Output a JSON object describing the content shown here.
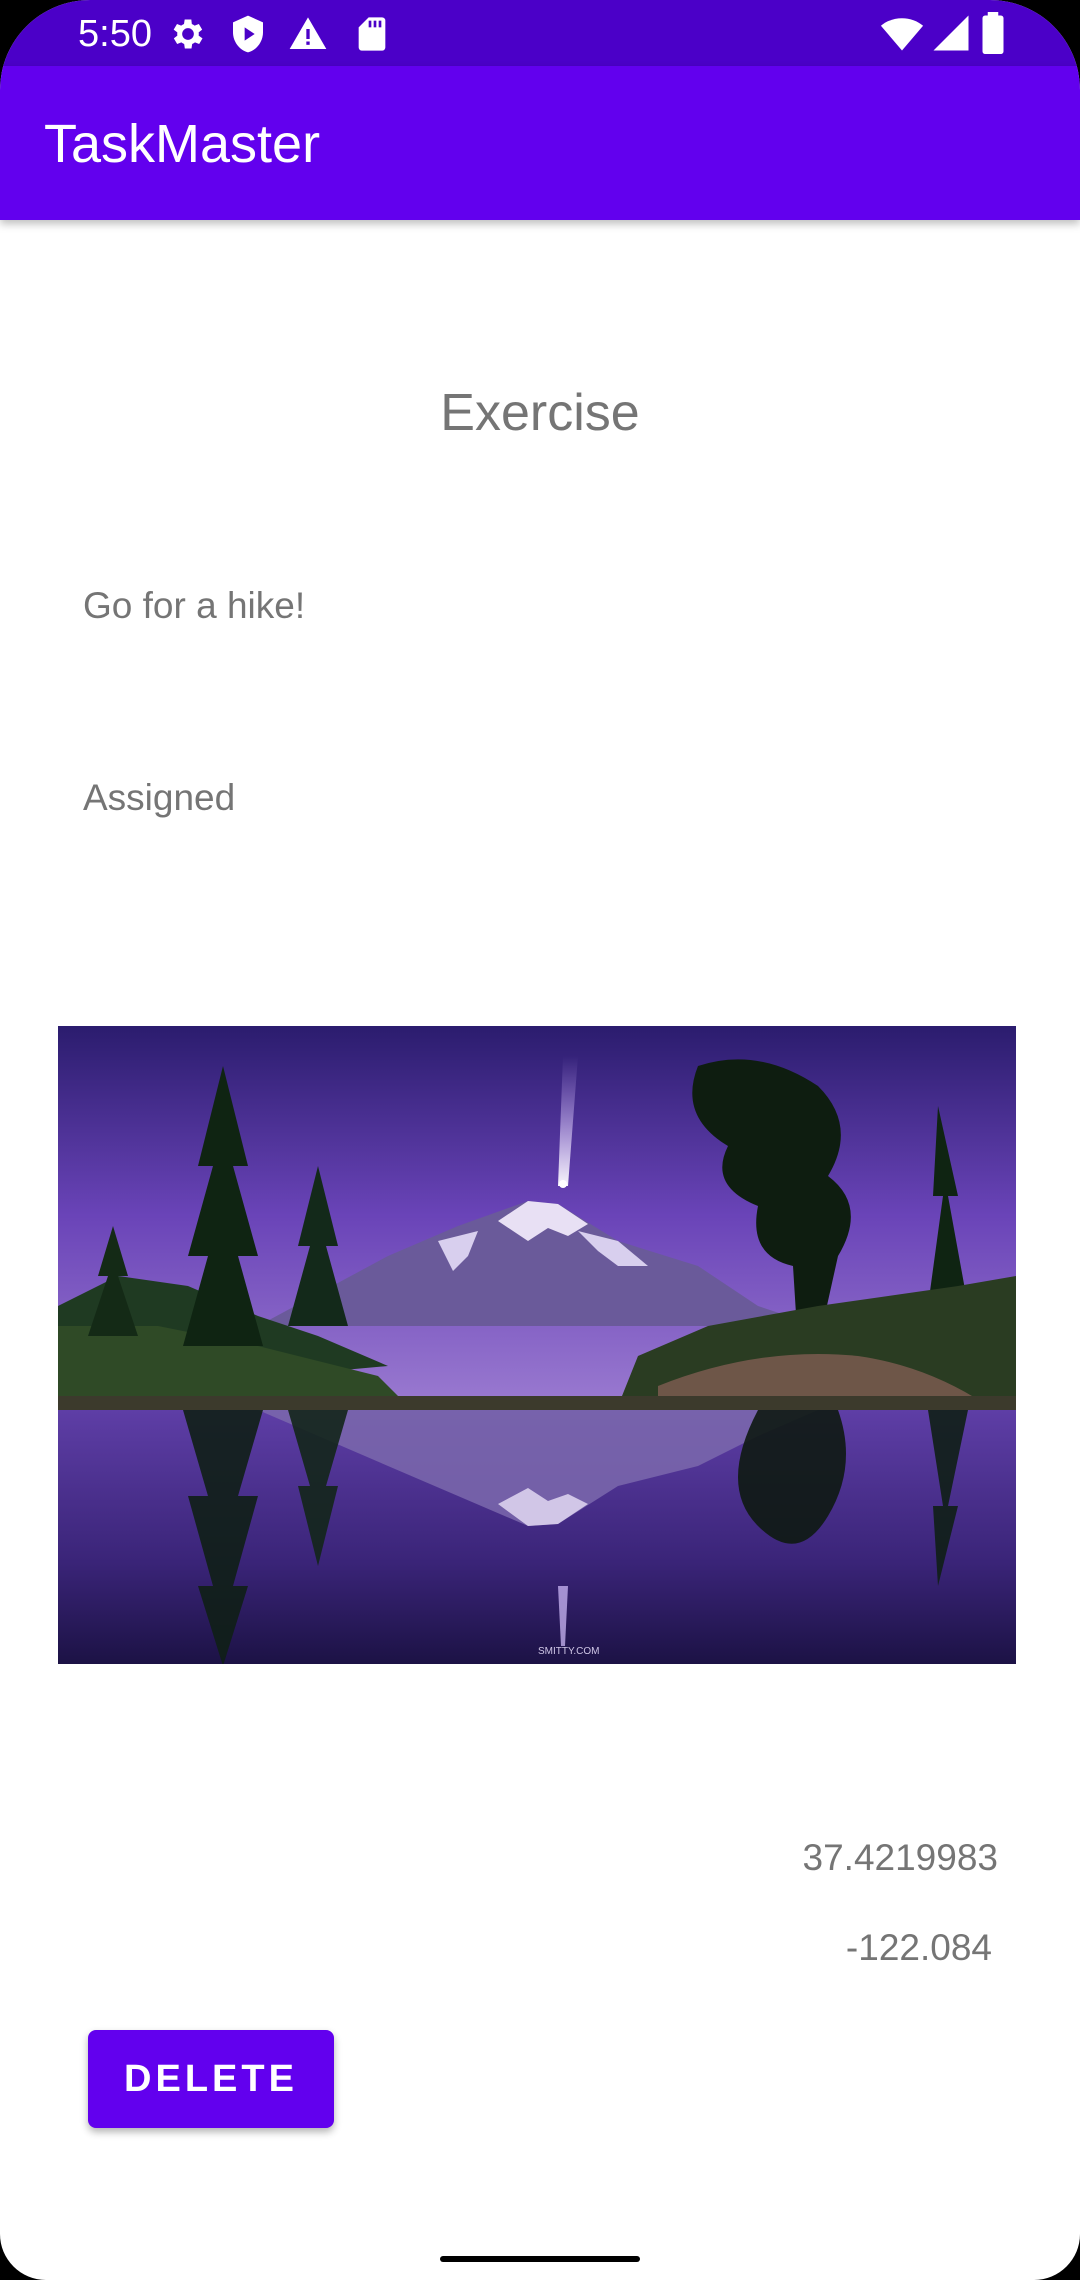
{
  "status_bar": {
    "time": "5:50",
    "left_icons": [
      "settings-gear-icon",
      "play-protect-icon",
      "warning-icon",
      "sd-card-icon"
    ],
    "right_icons": [
      "wifi-icon",
      "signal-icon",
      "battery-icon"
    ],
    "color": "#4b00c8"
  },
  "app_bar": {
    "title": "TaskMaster",
    "color": "#6200ee"
  },
  "task": {
    "title": "Exercise",
    "body": "Go for a hike!",
    "state": "Assigned",
    "image_watermark": "SMITTY.COM",
    "latitude": "37.4219983",
    "longitude": "-122.084"
  },
  "actions": {
    "delete_label": "DELETE"
  }
}
